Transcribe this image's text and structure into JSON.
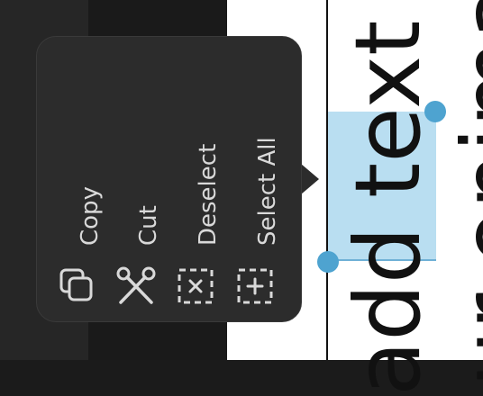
{
  "document": {
    "line1": "add text to",
    "line2": "ur onima"
  },
  "context_menu": {
    "items": [
      {
        "label": "Copy",
        "icon": "copy-icon"
      },
      {
        "label": "Cut",
        "icon": "scissors-icon"
      },
      {
        "label": "Deselect",
        "icon": "deselect-icon"
      },
      {
        "label": "Select All",
        "icon": "select-all-icon"
      }
    ]
  },
  "colors": {
    "menu_bg": "#2c2c2c",
    "menu_text": "#d9d9d9",
    "selection": "#b9def1",
    "handle": "#4ea3d0"
  }
}
